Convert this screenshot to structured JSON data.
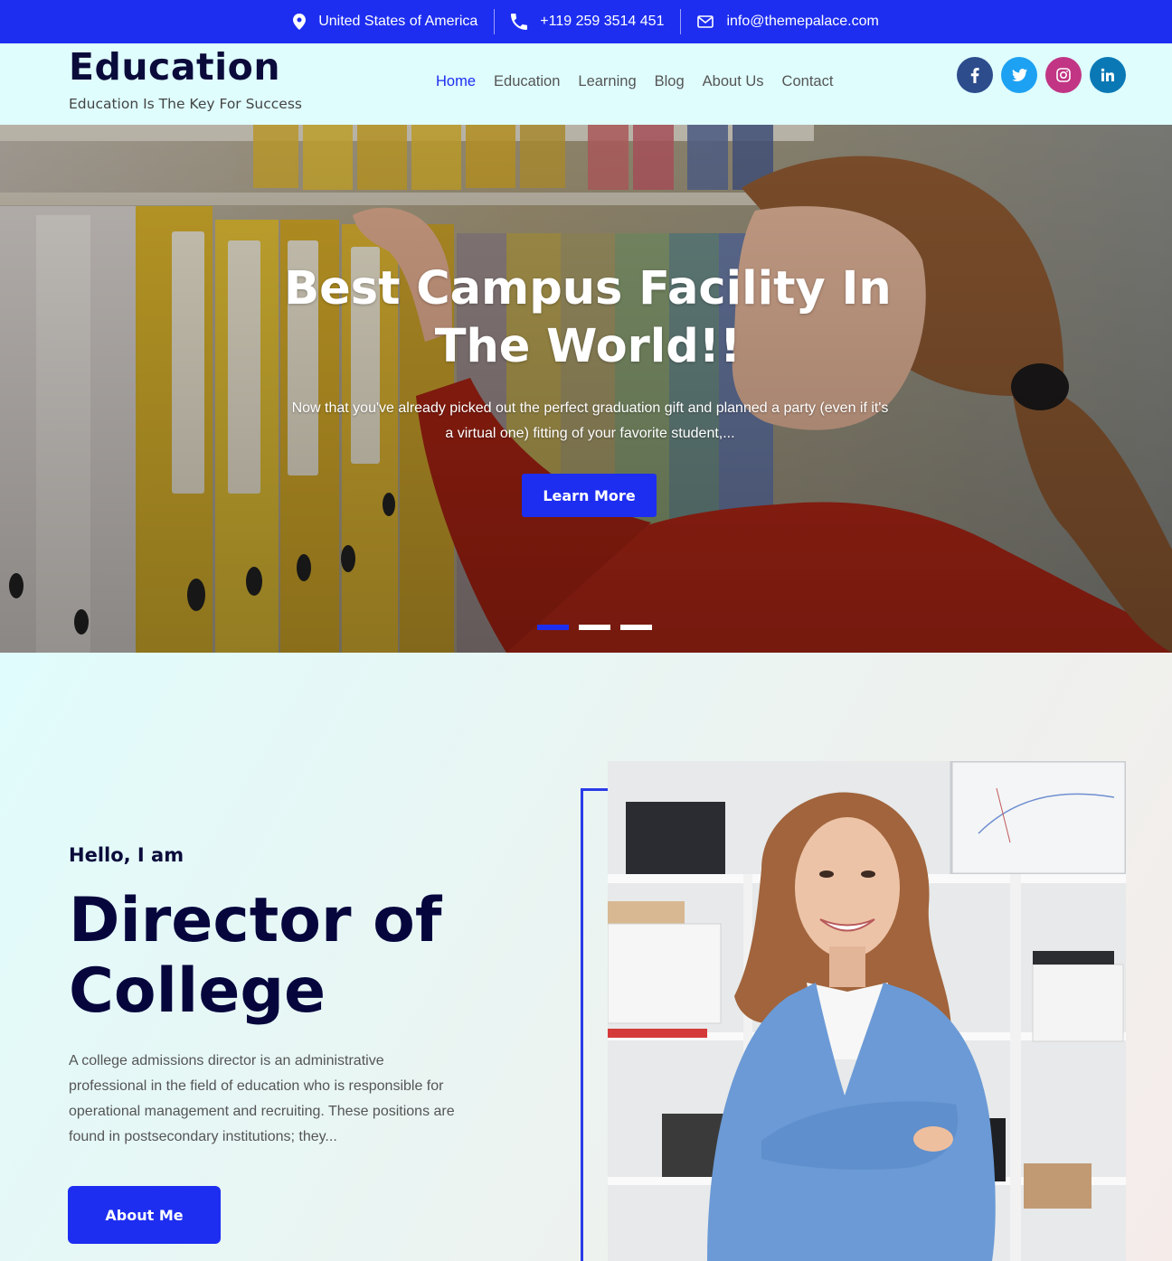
{
  "topbar": {
    "location": "United States of America",
    "phone": "+119 259 3514 451",
    "email": "info@themepalace.com"
  },
  "header": {
    "site_title": "Education",
    "tagline": "Education Is The Key For Success"
  },
  "nav": {
    "items": [
      {
        "label": "Home",
        "active": true
      },
      {
        "label": "Education",
        "active": false
      },
      {
        "label": "Learning",
        "active": false
      },
      {
        "label": "Blog",
        "active": false
      },
      {
        "label": "About Us",
        "active": false
      },
      {
        "label": "Contact",
        "active": false
      }
    ]
  },
  "social": [
    {
      "icon": "facebook-icon",
      "glyph": "f",
      "color": "#2d4c8c"
    },
    {
      "icon": "twitter-icon",
      "glyph": "t",
      "color": "#1da1f2"
    },
    {
      "icon": "instagram-icon",
      "glyph": "ig",
      "color": "#c13584"
    },
    {
      "icon": "linkedin-icon",
      "glyph": "in",
      "color": "#0a78b5"
    }
  ],
  "hero": {
    "title": "Best Campus Facility In The World!!",
    "text": "Now that you've already picked out the perfect graduation gift and planned a party (even if it's a virtual one) fitting of your favorite student,...",
    "button": "Learn More",
    "slides_total": 3,
    "active_slide": 1
  },
  "about": {
    "hello": "Hello, I am",
    "title": "Director of College",
    "text": "A college admissions director is an administrative professional in the field of education who is responsible for operational management and recruiting. These positions are found in postsecondary institutions; they...",
    "button": "About Me"
  },
  "colors": {
    "primary": "#1d2ef0",
    "header_bg": "#dffdfd",
    "dark_text": "#0b0b3b"
  }
}
